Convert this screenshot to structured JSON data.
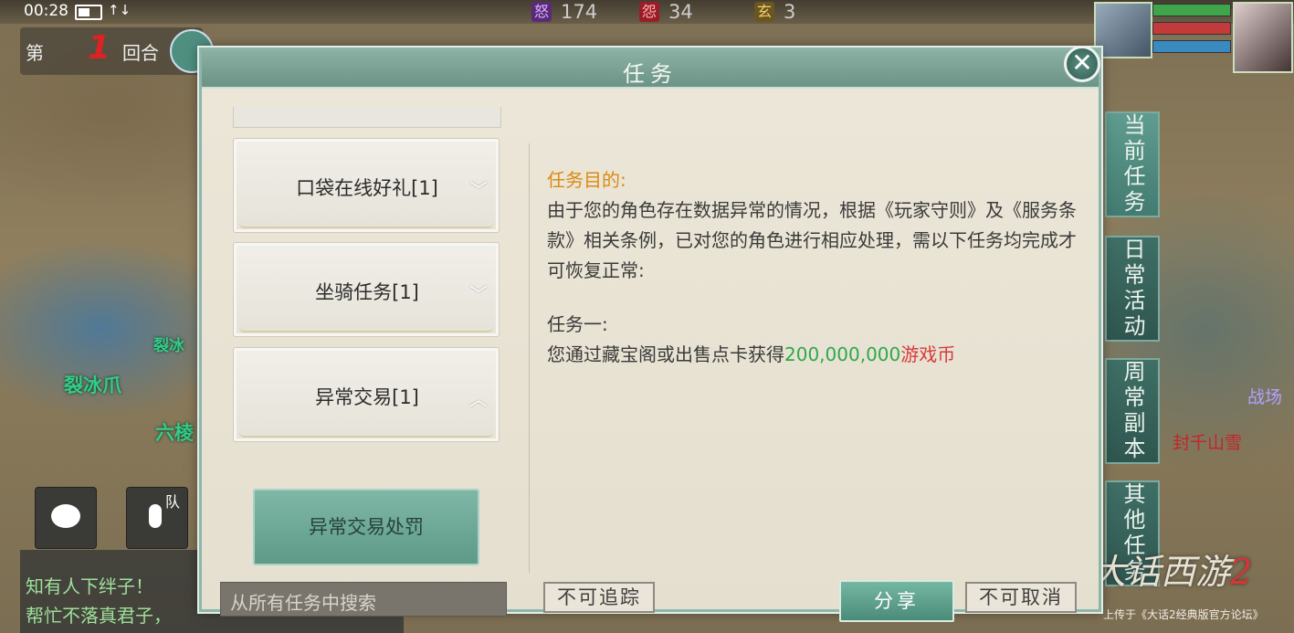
{
  "status": {
    "time": "00:28"
  },
  "top_stats": [
    {
      "icon": "anger-icon",
      "char": "怒",
      "value": "174",
      "color": "#7a3a9a"
    },
    {
      "icon": "resent-icon",
      "char": "怨",
      "value": "34",
      "color": "#b0202a"
    },
    {
      "icon": "mystic-icon",
      "char": "玄",
      "value": "3",
      "color": "#c8a030"
    }
  ],
  "battle": {
    "prefix": "第",
    "round": "1",
    "suffix": "回合"
  },
  "map_labels": {
    "a": "裂冰爪",
    "b": "六棱",
    "c": "裂冰"
  },
  "side_tabs": [
    "当前任务",
    "日常活动",
    "周常副本",
    "其他任务"
  ],
  "chat": {
    "lines": [
      "知有人下绊子！",
      "帮忙不落真君子，"
    ],
    "team_label": "队"
  },
  "right_labels": {
    "enemy": "战场",
    "name": "封千山雪"
  },
  "logo": {
    "main": "大话西游",
    "num": "2",
    "sub": "上传于《大话2经典版官方论坛》"
  },
  "dialog": {
    "title": "任务",
    "close": "✕",
    "quests": [
      {
        "label": "口袋在线好礼[1]",
        "chevron": "﹀"
      },
      {
        "label": "坐骑任务[1]",
        "chevron": "﹀"
      },
      {
        "label": "异常交易[1]",
        "chevron": "︿"
      }
    ],
    "selected_sub": "异常交易处罚",
    "search_placeholder": "从所有任务中搜索",
    "content": {
      "purpose_title": "任务目的:",
      "purpose_text": "由于您的角色存在数据异常的情况，根据《玩家守则》及《服务条款》相关条例，已对您的角色进行相应处理，需以下任务均完成才可恢复正常:",
      "task1_title": "任务一:",
      "task1_prefix": "您通过藏宝阁或出售点卡获得",
      "task1_amount": "200,000,000",
      "task1_unit": "游戏币"
    },
    "buttons": {
      "track": "不可追踪",
      "share": "分享",
      "cancel": "不可取消"
    }
  }
}
